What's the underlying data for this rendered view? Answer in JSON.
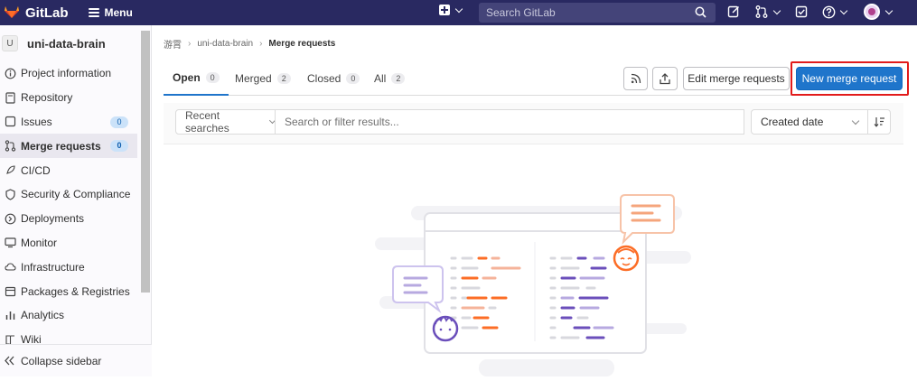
{
  "topbar": {
    "brand": "GitLab",
    "menu_label": "Menu",
    "search_placeholder": "Search GitLab",
    "icons": [
      "gitlab-logo-icon",
      "hamburger-icon",
      "plus-square-icon",
      "search-icon",
      "todo-pencil-icon",
      "merge-request-icon",
      "issues-check-icon",
      "help-icon",
      "user-avatar"
    ]
  },
  "sidebar": {
    "project_initial": "U",
    "project_name": "uni-data-brain",
    "items": [
      {
        "label": "Project information",
        "icon": "info-icon"
      },
      {
        "label": "Repository",
        "icon": "doc-icon"
      },
      {
        "label": "Issues",
        "icon": "issues-icon",
        "badge": "0"
      },
      {
        "label": "Merge requests",
        "icon": "merge-request-icon",
        "badge": "0",
        "active": true
      },
      {
        "label": "CI/CD",
        "icon": "rocket-icon"
      },
      {
        "label": "Security & Compliance",
        "icon": "shield-icon"
      },
      {
        "label": "Deployments",
        "icon": "deployments-icon"
      },
      {
        "label": "Monitor",
        "icon": "monitor-icon"
      },
      {
        "label": "Infrastructure",
        "icon": "cloud-icon"
      },
      {
        "label": "Packages & Registries",
        "icon": "package-icon"
      },
      {
        "label": "Analytics",
        "icon": "chart-icon"
      },
      {
        "label": "Wiki",
        "icon": "book-icon"
      }
    ],
    "collapse_label": "Collapse sidebar"
  },
  "breadcrumb": {
    "items": [
      "游霄",
      "uni-data-brain",
      "Merge requests"
    ]
  },
  "tabs": [
    {
      "label": "Open",
      "count": "0"
    },
    {
      "label": "Merged",
      "count": "2"
    },
    {
      "label": "Closed",
      "count": "0"
    },
    {
      "label": "All",
      "count": "2"
    }
  ],
  "actions": {
    "edit_label": "Edit merge requests",
    "new_label": "New merge request"
  },
  "filter": {
    "recent_label": "Recent searches",
    "placeholder": "Search or filter results...",
    "sort_label": "Created date"
  },
  "colors": {
    "navbar": "#292961",
    "primary": "#1f75cb",
    "highlight": "#e21b1b"
  }
}
